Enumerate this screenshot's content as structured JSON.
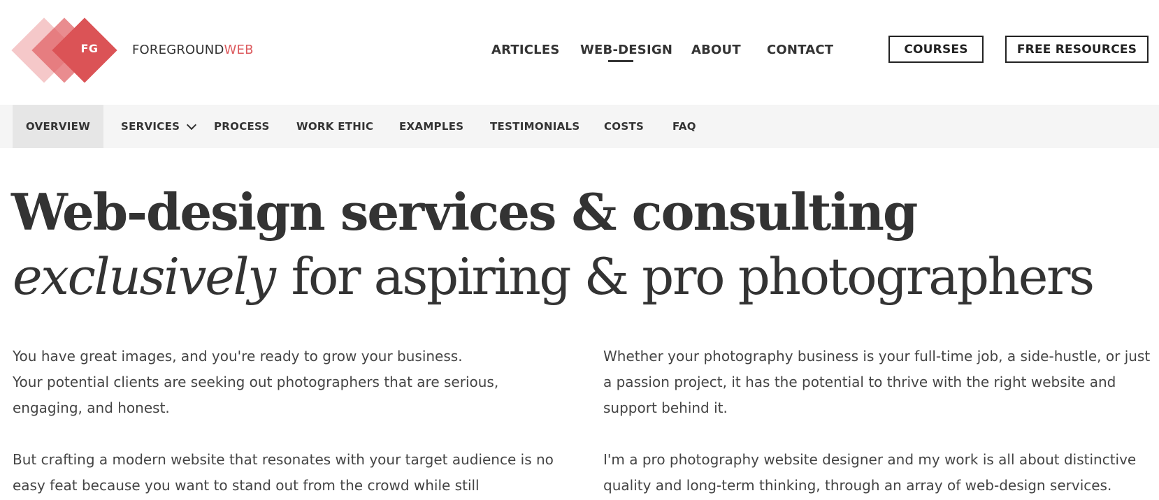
{
  "header": {
    "logo_text": "FG",
    "brand_main": "FOREGROUND",
    "brand_accent": "WEB",
    "nav": [
      "ARTICLES",
      "WEB-DESIGN",
      "ABOUT",
      "CONTACT"
    ],
    "active_nav": "WEB-DESIGN",
    "buttons": [
      "COURSES",
      "FREE RESOURCES"
    ]
  },
  "subnav": {
    "items": [
      "OVERVIEW",
      "SERVICES",
      "PROCESS",
      "WORK ETHIC",
      "EXAMPLES",
      "TESTIMONIALS",
      "COSTS",
      "FAQ"
    ],
    "active": "OVERVIEW"
  },
  "hero": {
    "line1": "Web-design services & consulting",
    "line2_italic": "exclusively",
    "line2_rest": "for aspiring & pro photographers"
  },
  "body": {
    "left": [
      "You have great images, and you're ready to grow your business.",
      "Your potential clients are seeking out photographers that are serious, engaging, and honest.",
      "But crafting a modern website that resonates with your target audience is no easy feat because you want to stand out from the crowd while still"
    ],
    "right": [
      "Whether your photography business is your full-time job, a side-hustle, or just a passion project, it has the potential to thrive with the right website and support behind it.",
      "I'm a pro photography website designer and my work is all about distinctive quality and long-term thinking, through an array of web-design services."
    ]
  },
  "colors": {
    "accent": "#dc5a5e",
    "text": "#333333",
    "subnav_bg": "#f5f5f5",
    "subnav_active_bg": "#e6e6e6"
  }
}
